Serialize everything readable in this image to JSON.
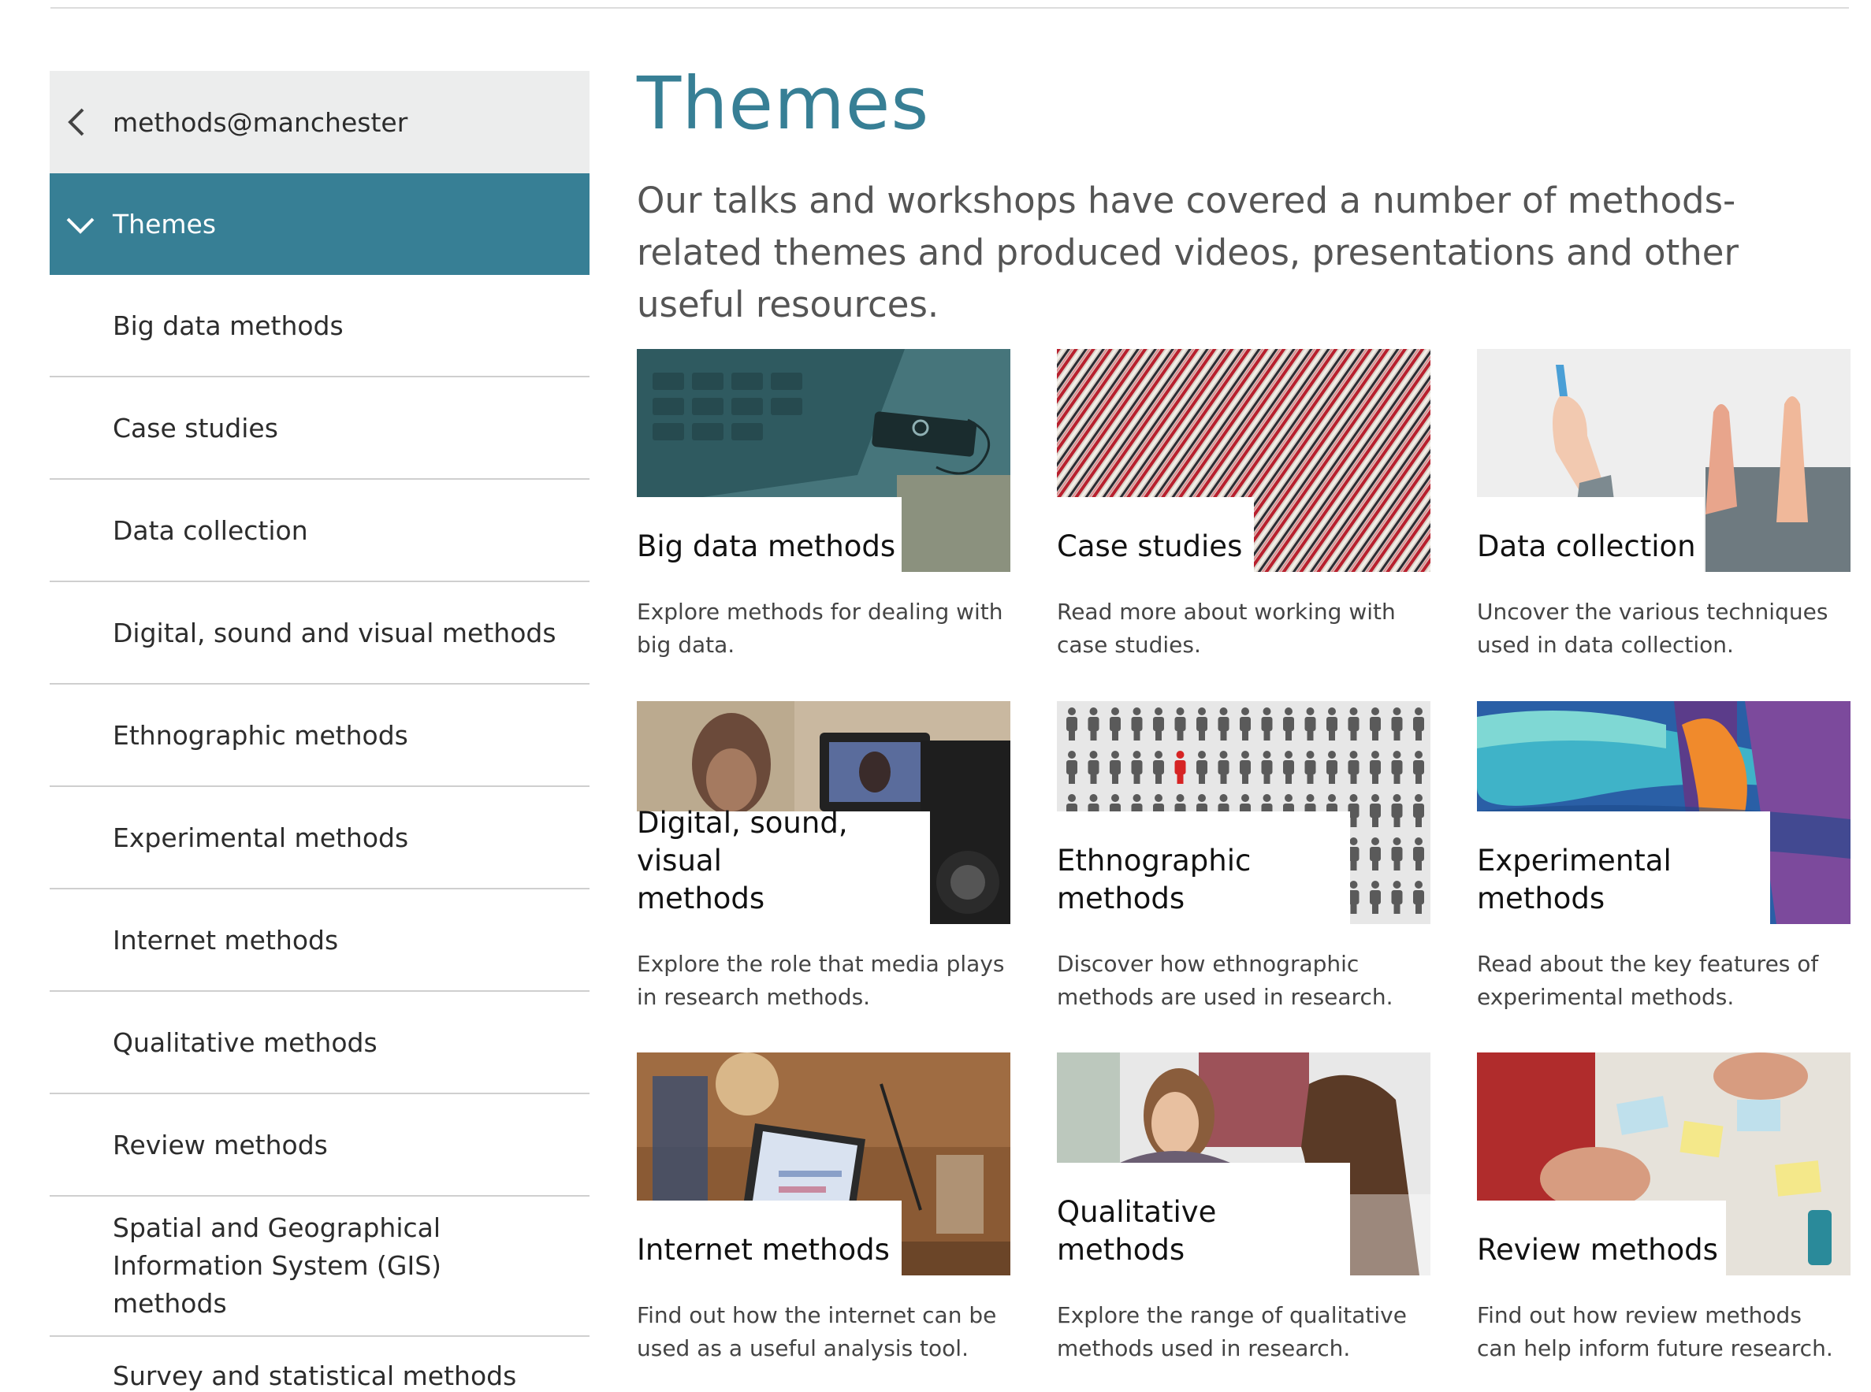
{
  "sidebar": {
    "parent_label": "methods@manchester",
    "active_label": "Themes",
    "items": [
      {
        "label": "Big data methods"
      },
      {
        "label": "Case studies"
      },
      {
        "label": "Data collection"
      },
      {
        "label": "Digital, sound and visual methods"
      },
      {
        "label": "Ethnographic methods"
      },
      {
        "label": "Experimental methods"
      },
      {
        "label": "Internet methods"
      },
      {
        "label": "Qualitative methods"
      },
      {
        "label": "Review methods"
      },
      {
        "label": "Spatial and Geographical Information System (GIS) methods"
      },
      {
        "label": "Survey and statistical methods"
      }
    ]
  },
  "main": {
    "title": "Themes",
    "intro": "Our talks and workshops have covered a number of methods-related themes and produced videos, presentations and other useful resources.",
    "cards": [
      {
        "title": "Big data methods",
        "description": "Explore methods for dealing with big data."
      },
      {
        "title": "Case studies",
        "description": "Read more about working with case studies."
      },
      {
        "title": "Data collection",
        "description": "Uncover the various techniques used in data collection."
      },
      {
        "title": "Digital, sound, visual methods",
        "description": "Explore the role that media plays in research methods."
      },
      {
        "title": "Ethnographic methods",
        "description": "Discover how ethnographic methods are used in research."
      },
      {
        "title": "Experimental methods",
        "description": "Read about the key features of experimental methods."
      },
      {
        "title": "Internet methods",
        "description": "Find out how the internet can be used as a useful analysis tool."
      },
      {
        "title": "Qualitative methods",
        "description": "Explore the range of qualitative methods used in research."
      },
      {
        "title": "Review methods",
        "description": "Find out how review methods can help inform future research."
      }
    ]
  },
  "colors": {
    "accent": "#377f95",
    "parent_bg": "#eceded",
    "rule": "#cfcfcf"
  },
  "icons": {
    "back": "chevron-left-icon",
    "expanded": "chevron-down-icon"
  }
}
